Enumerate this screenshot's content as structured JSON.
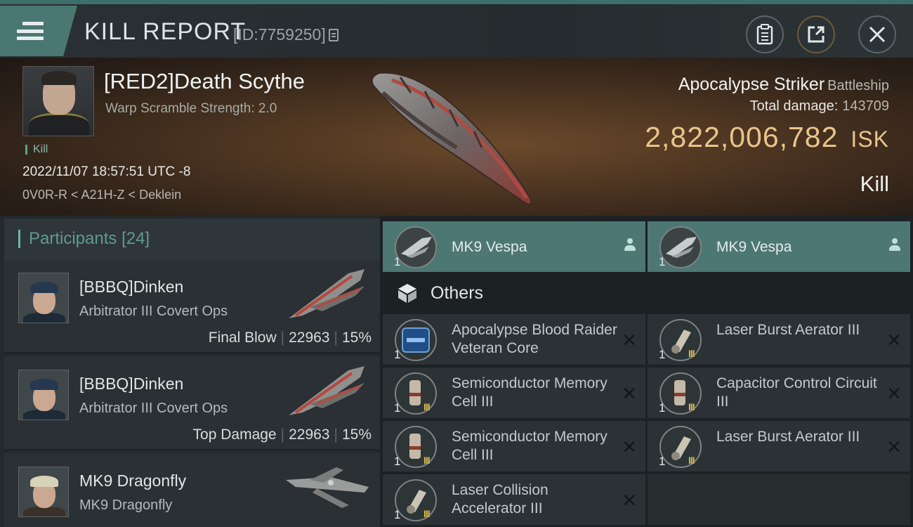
{
  "header": {
    "title": "KILL REPORT",
    "report_id": "[ID:7759250]"
  },
  "victim": {
    "name": "[RED2]Death Scythe",
    "warp_scramble": "Warp Scramble Strength: 2.0",
    "kill_tag": "Kill",
    "datetime": "2022/11/07 18:57:51 UTC -8",
    "location": "0V0R-R < A21H-Z < Deklein"
  },
  "ship": {
    "name": "Apocalypse Striker",
    "class": "Battleship",
    "total_damage_label": "Total damage:",
    "total_damage_value": "143709",
    "isk_value": "2,822,006,782",
    "isk_unit": "ISK",
    "result": "Kill"
  },
  "participants": {
    "label": "Participants",
    "count": "[24]",
    "rows": [
      {
        "name": "[BBBQ]Dinken",
        "ship": "Arbitrator III Covert Ops",
        "role": "Final Blow",
        "damage": "22963",
        "percent": "15%"
      },
      {
        "name": "[BBBQ]Dinken",
        "ship": "Arbitrator III Covert Ops",
        "role": "Top Damage",
        "damage": "22963",
        "percent": "15%"
      },
      {
        "name": "MK9 Dragonfly",
        "ship": "MK9 Dragonfly"
      }
    ]
  },
  "drones": [
    {
      "name": "MK9  Vespa",
      "qty": "1"
    },
    {
      "name": "MK9  Vespa",
      "qty": "1"
    }
  ],
  "others": {
    "label": "Others",
    "items": [
      {
        "name": "Apocalypse Blood Raider Veteran Core",
        "qty": "1",
        "tier": ""
      },
      {
        "name": "Laser Burst Aerator III",
        "qty": "1",
        "tier": "III"
      },
      {
        "name": "Semiconductor Memory Cell III",
        "qty": "1",
        "tier": "III"
      },
      {
        "name": "Capacitor Control Circuit III",
        "qty": "1",
        "tier": "III"
      },
      {
        "name": "Semiconductor Memory Cell III",
        "qty": "1",
        "tier": "III"
      },
      {
        "name": "Laser Burst Aerator III",
        "qty": "1",
        "tier": "III"
      },
      {
        "name": "Laser Collision Accelerator III",
        "qty": "1",
        "tier": "III"
      }
    ]
  },
  "icons": {
    "menu": "menu-icon",
    "clipboard": "clipboard-icon",
    "share": "share-icon",
    "close": "close-icon",
    "copy": "copy-icon",
    "remove": "x-icon",
    "person": "person-icon",
    "cube": "cube-icon"
  },
  "colors": {
    "accent": "#4d7773",
    "isk": "#e8c58a",
    "tier": "#d6b84a"
  }
}
